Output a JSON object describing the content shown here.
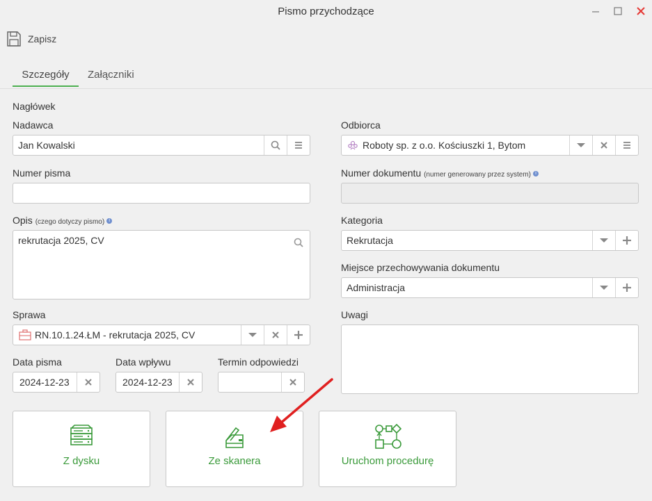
{
  "window": {
    "title": "Pismo przychodzące"
  },
  "toolbar": {
    "save_label": "Zapisz"
  },
  "tabs": [
    {
      "label": "Szczegóły"
    },
    {
      "label": "Załączniki"
    }
  ],
  "form": {
    "section_title": "Nagłówek",
    "nadawca": {
      "label": "Nadawca",
      "value": "Jan Kowalski"
    },
    "odbiorca": {
      "label": "Odbiorca",
      "value": "Roboty sp. z o.o. Kościuszki 1, Bytom"
    },
    "numer_pisma": {
      "label": "Numer pisma",
      "value": ""
    },
    "numer_dokumentu": {
      "label": "Numer dokumentu",
      "hint": "(numer generowany przez system)",
      "value": ""
    },
    "opis": {
      "label": "Opis",
      "hint": "(czego dotyczy pismo)",
      "value": "rekrutacja 2025, CV"
    },
    "kategoria": {
      "label": "Kategoria",
      "value": "Rekrutacja"
    },
    "miejsce": {
      "label": "Miejsce przechowywania dokumentu",
      "value": "Administracja"
    },
    "sprawa": {
      "label": "Sprawa",
      "value": "RN.10.1.24.ŁM - rekrutacja 2025, CV"
    },
    "uwagi": {
      "label": "Uwagi",
      "value": ""
    },
    "data_pisma": {
      "label": "Data pisma",
      "value": "2024-12-23"
    },
    "data_wplywu": {
      "label": "Data wpływu",
      "value": "2024-12-23"
    },
    "termin": {
      "label": "Termin odpowiedzi",
      "value": ""
    }
  },
  "actions": [
    {
      "label": "Z dysku",
      "icon": "server-icon"
    },
    {
      "label": "Ze skanera",
      "icon": "scanner-icon"
    },
    {
      "label": "Uruchom procedurę",
      "icon": "flowchart-icon"
    }
  ],
  "colors": {
    "accent": "#4caf50",
    "action_text": "#3a9a3a",
    "close": "#e53935",
    "arrow": "#e02020"
  }
}
